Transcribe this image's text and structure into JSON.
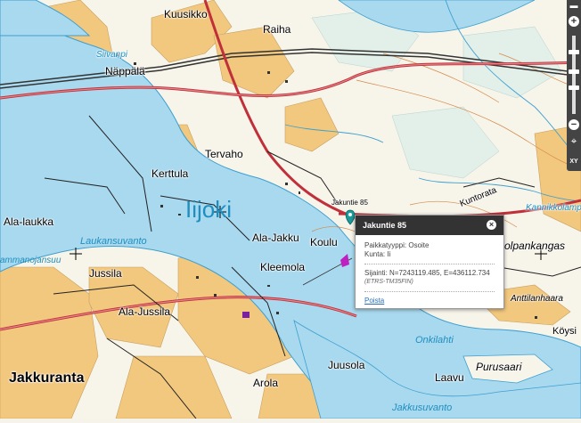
{
  "map": {
    "labels": {
      "kuusikko": "Kuusikko",
      "raiha": "Raiha",
      "nappala": "Näppälä",
      "siivanpi": "Siivanpi",
      "tervaho": "Tervaho",
      "kerttula": "Kerttula",
      "iijoki": "Iijoki",
      "ala_laukka": "Ala-laukka",
      "laukansuvanto": "Laukansuvanto",
      "ammanojansuu": "ammanojansuu",
      "jussila": "Jussila",
      "ala_jussila": "Ala-Jussila",
      "jakkuranta": "Jakkuranta",
      "ala_jakku": "Ala-Jakku",
      "koulu": "Koulu",
      "kleemola": "Kleemola",
      "juusola": "Juusola",
      "arola": "Arola",
      "laavu": "Laavu",
      "jakkusuvanto": "Jakkusuvanto",
      "onkilahti": "Onkilahti",
      "purusaari": "Purusaari",
      "koysi": "Köysi",
      "anttilanhaara": "Anttilanhaara",
      "olpankangas": "olpankangas",
      "kuntorata": "Kuntorata",
      "kannikkolampi": "Kannikkolamp",
      "jakuntie_marker": "Jakuntie 85"
    }
  },
  "controls": {
    "zoom_in": "+",
    "zoom_out": "−",
    "locate": "⌖",
    "xy": "XY"
  },
  "popup": {
    "title": "Jakuntie 85",
    "close": "×",
    "type_line": "Paikkatyyppi: Osoite",
    "municipality_line": "Kunta: Ii",
    "coords_line": "Sijainti: N=7243119.485, E=436112.734",
    "crs": "(ETRS-TM35FIN)",
    "remove_link": "Poista"
  }
}
